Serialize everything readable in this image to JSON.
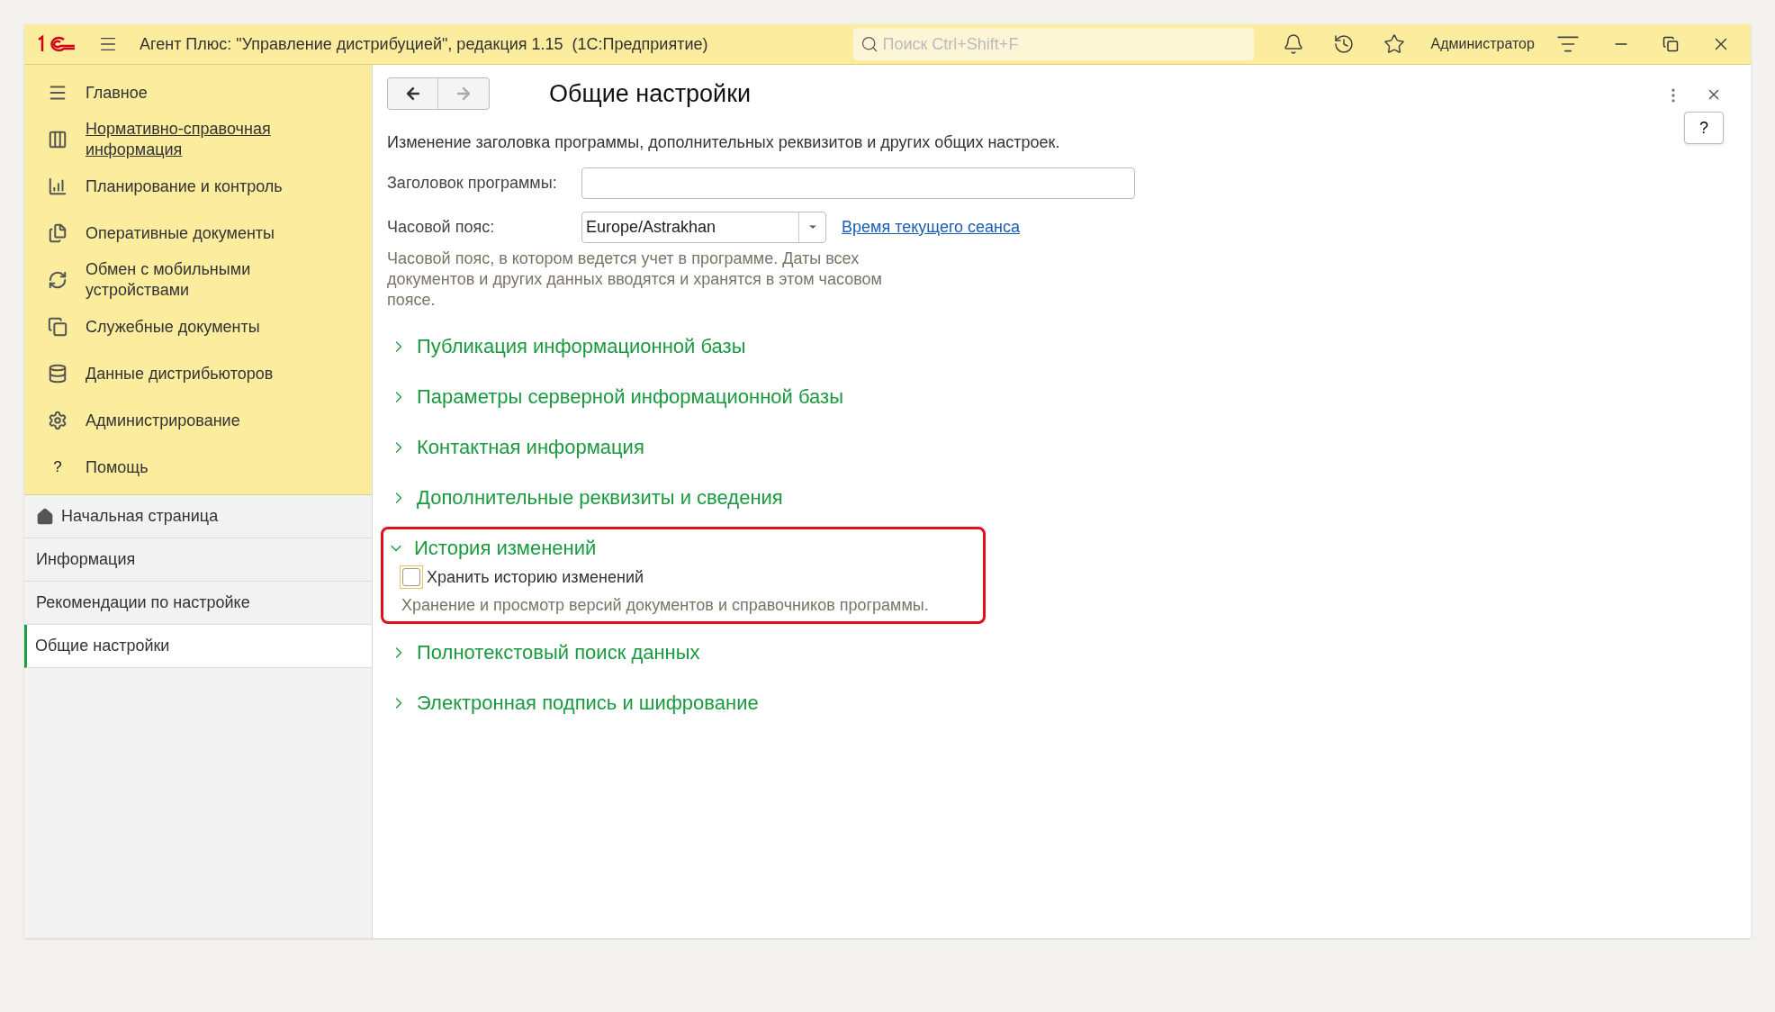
{
  "app_bar": {
    "title": "Агент Плюс: \"Управление дистрибуцией\", редакция 1.15  (1С:Предприятие)",
    "search": {
      "placeholder": "Поиск Ctrl+Shift+F"
    },
    "user": "Администратор"
  },
  "sidebar": {
    "sections": [
      {
        "label": "Главное",
        "hovered": false
      },
      {
        "label": "Нормативно-справочная информация",
        "hovered": true
      },
      {
        "label": "Планирование и контроль",
        "hovered": false
      },
      {
        "label": "Оперативные документы",
        "hovered": false
      },
      {
        "label": "Обмен с мобильными устройствами",
        "hovered": false
      },
      {
        "label": "Служебные документы",
        "hovered": false
      },
      {
        "label": "Данные дистрибьюторов",
        "hovered": false
      },
      {
        "label": "Администрирование",
        "hovered": false
      },
      {
        "label": "Помощь",
        "hovered": false,
        "icon_glyph": "?"
      }
    ],
    "pages": [
      {
        "label": "Начальная страница",
        "selected": false
      },
      {
        "label": "Информация",
        "selected": false
      },
      {
        "label": "Рекомендации по настройке",
        "selected": false
      },
      {
        "label": "Общие настройки",
        "selected": true
      }
    ]
  },
  "form": {
    "title": "Общие настройки",
    "help": "?",
    "description": "Изменение заголовка программы, дополнительных реквизитов и других общих настроек.",
    "program_title": {
      "label": "Заголовок программы:"
    },
    "timezone": {
      "label": "Часовой пояс:",
      "value": "Europe/Astrakhan",
      "link": "Время текущего сеанса",
      "hint": "Часовой пояс, в котором ведется учет в программе. Даты всех документов и других данных вводятся и хранятся в этом часовом поясе."
    },
    "sections": [
      {
        "title": "Публикация информационной базы",
        "expanded": false,
        "highlighted": false
      },
      {
        "title": "Параметры серверной информационной базы",
        "expanded": false,
        "highlighted": false
      },
      {
        "title": "Контактная информация",
        "expanded": false,
        "highlighted": false
      },
      {
        "title": "Дополнительные реквизиты и сведения",
        "expanded": false,
        "highlighted": false
      },
      {
        "title": "История изменений",
        "expanded": true,
        "highlighted": true,
        "checkbox": {
          "label": "Хранить историю изменений",
          "checked": false
        },
        "hint": "Хранение и просмотр версий документов и справочников программы."
      },
      {
        "title": "Полнотекстовый поиск данных",
        "expanded": false,
        "highlighted": false
      },
      {
        "title": "Электронная подпись и шифрование",
        "expanded": false,
        "highlighted": false
      }
    ]
  }
}
